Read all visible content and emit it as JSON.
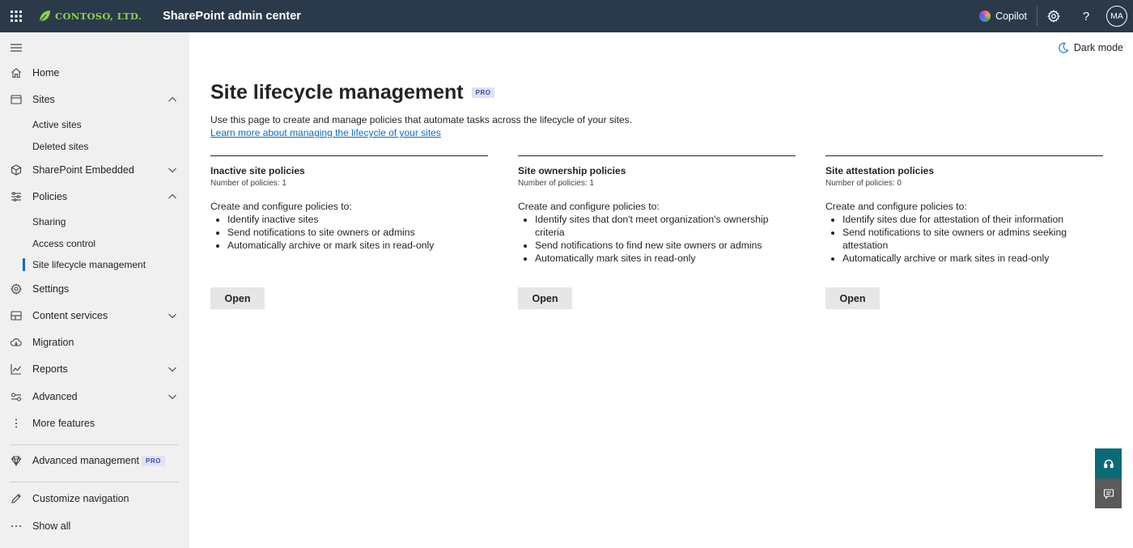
{
  "header": {
    "company": "CONTOSO, LTD.",
    "app_title": "SharePoint admin center",
    "copilot_label": "Copilot",
    "avatar_initials": "MA",
    "bar_color": "#2b3a4a",
    "logo_color": "#8fd14f"
  },
  "sidebar": {
    "items": [
      {
        "label": "Home",
        "icon": "home-icon"
      },
      {
        "label": "Sites",
        "icon": "sites-icon",
        "expanded": true
      },
      {
        "label": "Active sites"
      },
      {
        "label": "Deleted sites"
      },
      {
        "label": "SharePoint Embedded",
        "icon": "cube-icon",
        "expanded": false
      },
      {
        "label": "Policies",
        "icon": "policies-icon",
        "expanded": true
      },
      {
        "label": "Sharing"
      },
      {
        "label": "Access control"
      },
      {
        "label": "Site lifecycle management",
        "selected": true
      },
      {
        "label": "Settings",
        "icon": "gear-icon"
      },
      {
        "label": "Content services",
        "icon": "content-services-icon",
        "expanded": false
      },
      {
        "label": "Migration",
        "icon": "migration-icon"
      },
      {
        "label": "Reports",
        "icon": "reports-icon",
        "expanded": false
      },
      {
        "label": "Advanced",
        "icon": "advanced-icon",
        "expanded": false
      },
      {
        "label": "More features",
        "icon": "more-features-icon"
      },
      {
        "label": "Advanced management",
        "icon": "diamond-icon",
        "badge": "PRO"
      },
      {
        "label": "Customize navigation",
        "icon": "pencil-icon"
      },
      {
        "label": "Show all",
        "icon": "ellipsis-icon"
      }
    ]
  },
  "main": {
    "dark_mode_label": "Dark mode",
    "title": "Site lifecycle management",
    "title_badge": "PRO",
    "description": "Use this page to create and manage policies that automate tasks across the lifecycle of your sites.",
    "learn_more": "Learn more about managing the lifecycle of your sites",
    "cards": [
      {
        "title": "Inactive site policies",
        "count": "Number of policies: 1",
        "intro": "Create and configure policies to:",
        "bullets": [
          "Identify inactive sites",
          "Send notifications to site owners or admins",
          "Automatically archive or mark sites in read-only"
        ],
        "button": "Open"
      },
      {
        "title": "Site ownership policies",
        "count": "Number of policies: 1",
        "intro": "Create and configure policies to:",
        "bullets": [
          "Identify sites that don't meet organization's ownership criteria",
          "Send notifications to find new site owners or admins",
          "Automatically mark sites in read-only"
        ],
        "button": "Open"
      },
      {
        "title": "Site attestation policies",
        "count": "Number of policies: 0",
        "intro": "Create and configure policies to:",
        "bullets": [
          "Identify sites due for attestation of their information",
          "Send notifications to site owners or admins seeking attestation",
          "Automatically archive or mark sites in read-only"
        ],
        "button": "Open"
      }
    ]
  },
  "floating": {
    "help_color": "#0b6a77",
    "feedback_color": "#5a5a5a"
  }
}
